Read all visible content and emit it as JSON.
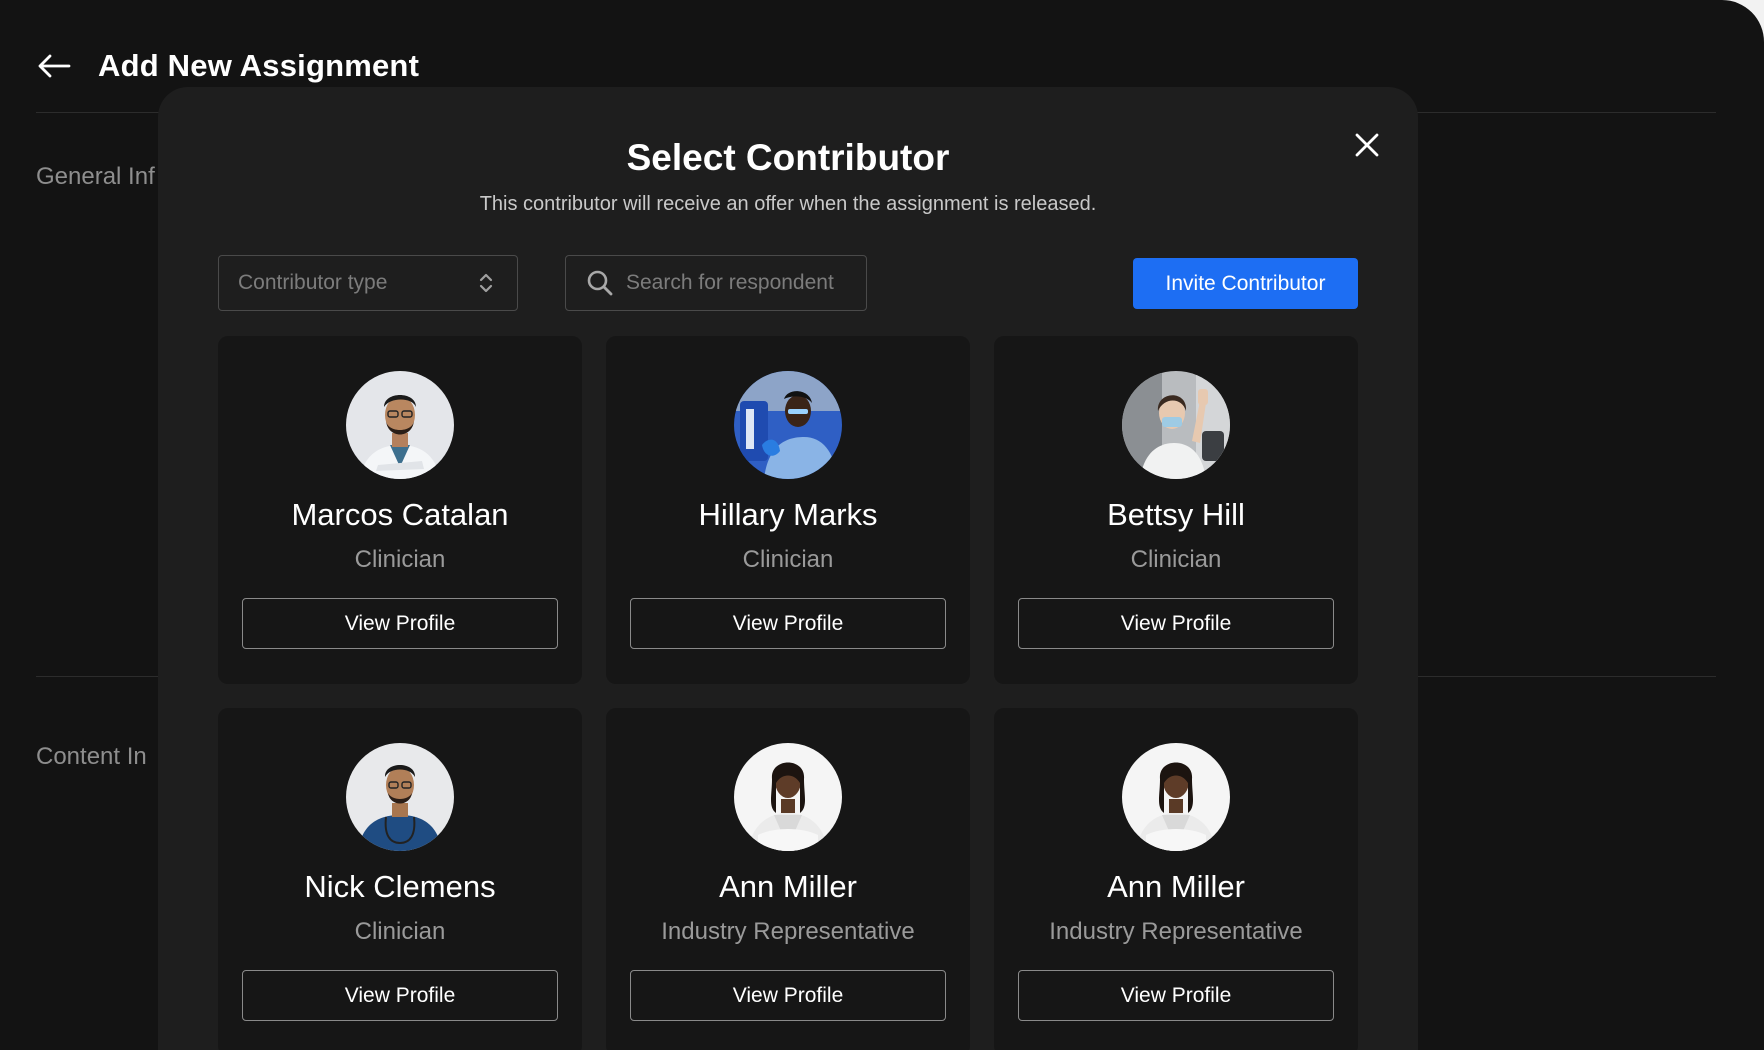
{
  "page": {
    "title": "Add New Assignment",
    "sections": [
      "General Inf",
      "Content In"
    ]
  },
  "modal": {
    "title": "Select Contributor",
    "subtitle": "This contributor will receive an offer when the assignment is released.",
    "type_select": {
      "placeholder": "Contributor type"
    },
    "search": {
      "placeholder": "Search for respondent",
      "value": ""
    },
    "invite_label": "Invite Contributor",
    "contributors": [
      {
        "name": "Marcos Catalan",
        "role": "Clinician",
        "button": "View Profile",
        "avatar": "avatar-white-coat-man"
      },
      {
        "name": "Hillary Marks",
        "role": "Clinician",
        "button": "View Profile",
        "avatar": "avatar-lab-blue"
      },
      {
        "name": "Bettsy Hill",
        "role": "Clinician",
        "button": "View Profile",
        "avatar": "avatar-lab-mask"
      },
      {
        "name": "Nick Clemens",
        "role": "Clinician",
        "button": "View Profile",
        "avatar": "avatar-blue-scrubs-man"
      },
      {
        "name": "Ann Miller",
        "role": "Industry Representative",
        "button": "View Profile",
        "avatar": "avatar-white-suit-woman"
      },
      {
        "name": "Ann Miller",
        "role": "Industry Representative",
        "button": "View Profile",
        "avatar": "avatar-white-suit-woman"
      }
    ]
  },
  "colors": {
    "background": "#131313",
    "modal": "#1e1e1e",
    "card": "#161616",
    "accent": "#1d6ef3"
  },
  "icons": {
    "back": "arrow-left-icon",
    "close": "close-icon",
    "search": "search-icon",
    "select": "chevron-up-down-icon"
  }
}
